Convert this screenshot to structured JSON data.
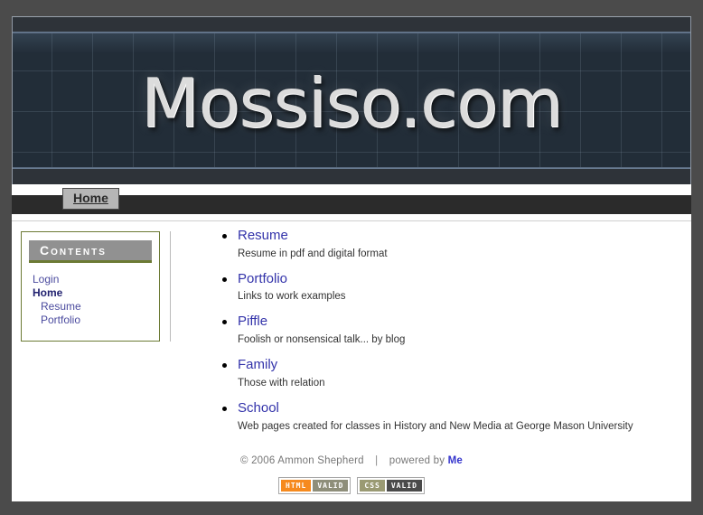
{
  "site": {
    "logo_text": "Mossiso.com"
  },
  "nav": {
    "tabs": [
      {
        "label": "Home",
        "active": true
      }
    ]
  },
  "sidebar": {
    "title": "Contents",
    "items": [
      {
        "label": "Login",
        "current": false,
        "indent": false
      },
      {
        "label": "Home",
        "current": true,
        "indent": false
      },
      {
        "label": "Resume",
        "current": false,
        "indent": true
      },
      {
        "label": "Portfolio",
        "current": false,
        "indent": true
      }
    ]
  },
  "main": {
    "items": [
      {
        "title": "Resume",
        "desc": "Resume in pdf and digital format"
      },
      {
        "title": "Portfolio",
        "desc": "Links to work examples"
      },
      {
        "title": "Piffle",
        "desc": "Foolish or nonsensical talk... by blog"
      },
      {
        "title": "Family",
        "desc": "Those with relation"
      },
      {
        "title": "School",
        "desc": "Web pages created for classes in History and New Media at George Mason University"
      }
    ]
  },
  "footer": {
    "copyright": "© 2006 Ammon Shepherd",
    "separator": "|",
    "powered_by_text": "powered by",
    "powered_by_link": "Me",
    "badges": [
      {
        "left": "HTML",
        "right": "VALID",
        "left_color": "#f68a1e",
        "right_color": "#8e8e7a"
      },
      {
        "left": "CSS",
        "right": "VALID",
        "left_color": "#9a9a73",
        "right_color": "#4a4a4a"
      }
    ]
  },
  "colors": {
    "page_background": "#4b4b4b",
    "banner_background": "#222d38",
    "nav_strip": "#2b2b2b",
    "sidebar_accent": "#6c7a34",
    "link_blue": "#3333aa"
  }
}
